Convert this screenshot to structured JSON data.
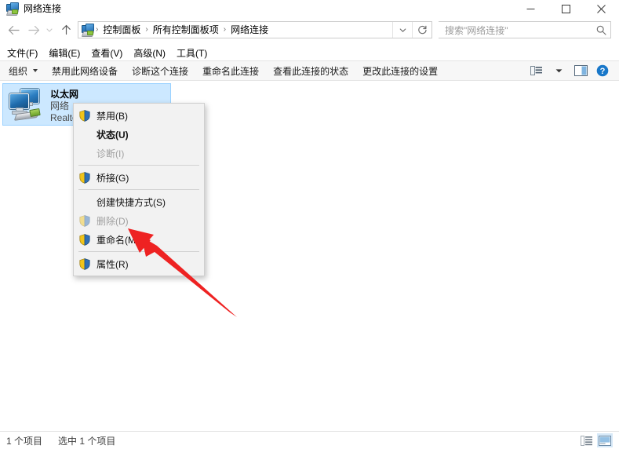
{
  "window": {
    "title": "网络连接",
    "icon": "network-connections-icon",
    "controls": {
      "minimize": "minimize-icon",
      "maximize": "maximize-icon",
      "close": "close-icon"
    }
  },
  "navigation": {
    "back": "back-arrow-icon",
    "forward": "forward-arrow-icon",
    "recent": "recent-locations-icon",
    "up": "up-arrow-icon"
  },
  "address_bar": {
    "icon": "network-connections-icon",
    "crumbs": [
      "控制面板",
      "所有控制面板项",
      "网络连接"
    ],
    "separator": "›",
    "dropdown": "chevron-down-icon",
    "refresh": "refresh-icon"
  },
  "search": {
    "placeholder": "搜索\"网络连接\"",
    "icon": "search-icon"
  },
  "menubar": {
    "items": [
      {
        "label": "文件(F)"
      },
      {
        "label": "编辑(E)"
      },
      {
        "label": "查看(V)"
      },
      {
        "label": "高级(N)"
      },
      {
        "label": "工具(T)"
      }
    ]
  },
  "toolbar": {
    "organize": "组织",
    "items": [
      {
        "label": "禁用此网络设备"
      },
      {
        "label": "诊断这个连接"
      },
      {
        "label": "重命名此连接"
      },
      {
        "label": "查看此连接的状态"
      },
      {
        "label": "更改此连接的设置"
      }
    ],
    "right_icons": [
      {
        "name": "change-view-icon"
      },
      {
        "name": "view-dropdown-icon"
      },
      {
        "name": "preview-pane-icon"
      },
      {
        "name": "help-icon"
      }
    ]
  },
  "connections": [
    {
      "name": "以太网",
      "status": "网络",
      "device": "Realtek",
      "icon": "ethernet-adapter-icon",
      "selected": true
    }
  ],
  "context_menu": {
    "items": [
      {
        "label": "禁用(B)",
        "icon": "shield-icon",
        "bold": false,
        "disabled": false,
        "separator_after": false
      },
      {
        "label": "状态(U)",
        "icon": null,
        "bold": true,
        "disabled": false,
        "separator_after": false
      },
      {
        "label": "诊断(I)",
        "icon": null,
        "bold": false,
        "disabled": true,
        "separator_after": true
      },
      {
        "label": "桥接(G)",
        "icon": "shield-icon",
        "bold": false,
        "disabled": false,
        "separator_after": true
      },
      {
        "label": "创建快捷方式(S)",
        "icon": null,
        "bold": false,
        "disabled": false,
        "separator_after": false
      },
      {
        "label": "删除(D)",
        "icon": "shield-icon",
        "bold": false,
        "disabled": true,
        "separator_after": false
      },
      {
        "label": "重命名(M)",
        "icon": "shield-icon",
        "bold": false,
        "disabled": false,
        "separator_after": true
      },
      {
        "label": "属性(R)",
        "icon": "shield-icon",
        "bold": false,
        "disabled": false,
        "separator_after": false
      }
    ]
  },
  "annotation": {
    "arrow_color": "#ee2222",
    "points_at": "属性(R)"
  },
  "statusbar": {
    "item_count": "1 个项目",
    "selection": "选中 1 个项目",
    "views": [
      {
        "name": "details-view-button",
        "active": false
      },
      {
        "name": "large-icons-view-button",
        "active": true
      }
    ]
  }
}
